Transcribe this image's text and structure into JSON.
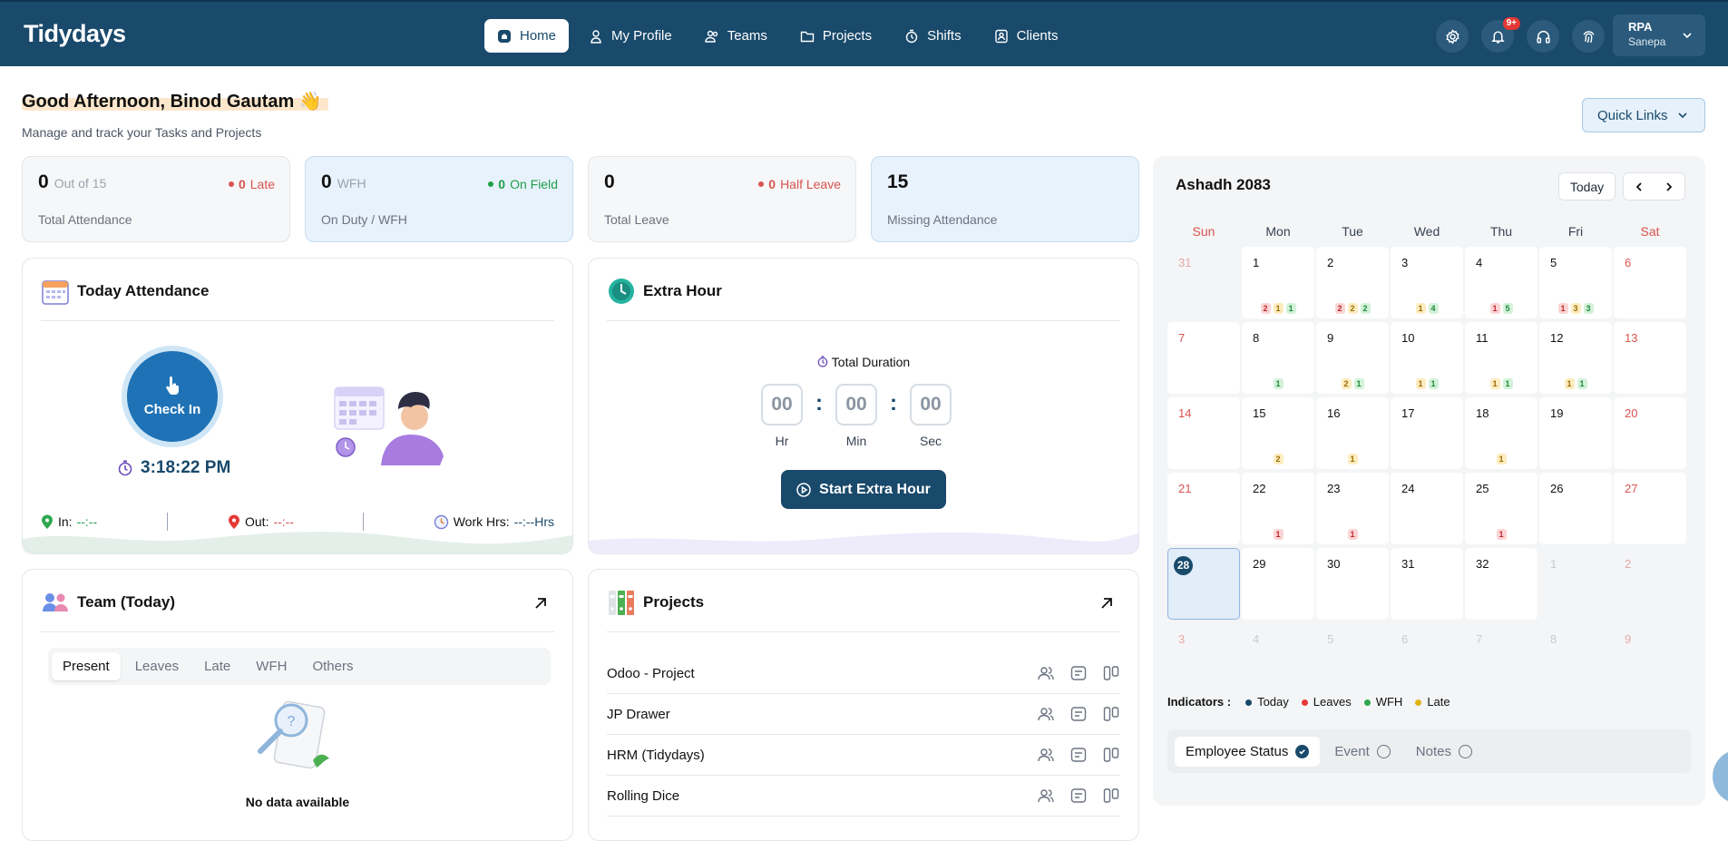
{
  "header": {
    "logo": "Tidydays",
    "nav": [
      "Home",
      "My Profile",
      "Teams",
      "Projects",
      "Shifts",
      "Clients"
    ],
    "notif_count": "9+",
    "user_line1": "RPA",
    "user_line2": "Sanepa"
  },
  "greeting": {
    "title": "Good Afternoon, Binod Gautam 👋",
    "subtitle": "Manage and track your Tasks and Projects",
    "quick_links": "Quick Links"
  },
  "stats": [
    {
      "value": "0",
      "of": "Out of 15",
      "label": "Total Attendance",
      "side_value": "0",
      "side_label": "Late",
      "side_color": "#d9534f"
    },
    {
      "value": "0",
      "of": "WFH",
      "label": "On Duty / WFH",
      "side_value": "0",
      "side_label": "On Field",
      "side_color": "#1e9e4a"
    },
    {
      "value": "0",
      "of": "",
      "label": "Total Leave",
      "side_value": "0",
      "side_label": "Half Leave",
      "side_color": "#d9534f"
    },
    {
      "value": "15",
      "of": "",
      "label": "Missing Attendance",
      "side_value": "",
      "side_label": "",
      "side_color": ""
    }
  ],
  "attendance": {
    "title": "Today Attendance",
    "check_in": "Check In",
    "time": "3:18:22 PM",
    "in_label": "In:",
    "in_value": "--:--",
    "out_label": "Out:",
    "out_value": "--:--",
    "work_label": "Work Hrs:",
    "work_value": "--:--",
    "work_unit": "Hrs"
  },
  "extra": {
    "title": "Extra Hour",
    "duration_label": "Total Duration",
    "hr": "00",
    "min": "00",
    "sec": "00",
    "hr_label": "Hr",
    "min_label": "Min",
    "sec_label": "Sec",
    "button": "Start Extra Hour"
  },
  "team": {
    "title": "Team (Today)",
    "tabs": [
      "Present",
      "Leaves",
      "Late",
      "WFH",
      "Others"
    ],
    "empty": "No data available"
  },
  "projects": {
    "title": "Projects",
    "items": [
      "Odoo - Project",
      "JP Drawer",
      "HRM (Tidydays)",
      "Rolling Dice"
    ]
  },
  "calendar": {
    "title": "Ashadh 2083",
    "today_btn": "Today",
    "weekdays": [
      "Sun",
      "Mon",
      "Tue",
      "Wed",
      "Thu",
      "Fri",
      "Sat"
    ],
    "days": [
      {
        "n": "31",
        "out": true
      },
      {
        "n": "1",
        "chips": [
          "2r",
          "1y",
          "1g"
        ]
      },
      {
        "n": "2",
        "chips": [
          "2r",
          "2y",
          "2g"
        ]
      },
      {
        "n": "3",
        "chips": [
          "1y",
          "4g"
        ]
      },
      {
        "n": "4",
        "chips": [
          "1r",
          "5g"
        ]
      },
      {
        "n": "5",
        "chips": [
          "1r",
          "3y",
          "3g"
        ]
      },
      {
        "n": "6"
      },
      {
        "n": "7"
      },
      {
        "n": "8",
        "chips": [
          "1g"
        ]
      },
      {
        "n": "9",
        "chips": [
          "2y",
          "1g"
        ]
      },
      {
        "n": "10",
        "chips": [
          "1y",
          "1g"
        ]
      },
      {
        "n": "11",
        "chips": [
          "1y",
          "1g"
        ]
      },
      {
        "n": "12",
        "chips": [
          "1y",
          "1g"
        ]
      },
      {
        "n": "13"
      },
      {
        "n": "14"
      },
      {
        "n": "15",
        "chips": [
          "2y"
        ]
      },
      {
        "n": "16",
        "chips": [
          "1y"
        ]
      },
      {
        "n": "17"
      },
      {
        "n": "18",
        "chips": [
          "1y"
        ]
      },
      {
        "n": "19"
      },
      {
        "n": "20"
      },
      {
        "n": "21"
      },
      {
        "n": "22",
        "chips": [
          "1r"
        ]
      },
      {
        "n": "23",
        "chips": [
          "1r"
        ]
      },
      {
        "n": "24"
      },
      {
        "n": "25",
        "chips": [
          "1r"
        ]
      },
      {
        "n": "26"
      },
      {
        "n": "27"
      },
      {
        "n": "28",
        "today": true
      },
      {
        "n": "29"
      },
      {
        "n": "30"
      },
      {
        "n": "31"
      },
      {
        "n": "32"
      },
      {
        "n": "1",
        "out": true
      },
      {
        "n": "2",
        "out": true
      },
      {
        "n": "3",
        "out": true
      },
      {
        "n": "4",
        "out": true
      },
      {
        "n": "5",
        "out": true
      },
      {
        "n": "6",
        "out": true
      },
      {
        "n": "7",
        "out": true
      },
      {
        "n": "8",
        "out": true
      },
      {
        "n": "9",
        "out": true
      }
    ],
    "indicators_label": "Indicators :",
    "indicators": [
      {
        "label": "Today",
        "color": "#19496b"
      },
      {
        "label": "Leaves",
        "color": "#e53935"
      },
      {
        "label": "WFH",
        "color": "#2ea84f"
      },
      {
        "label": "Late",
        "color": "#e0b416"
      }
    ],
    "filters": [
      "Employee Status",
      "Event",
      "Notes"
    ]
  }
}
